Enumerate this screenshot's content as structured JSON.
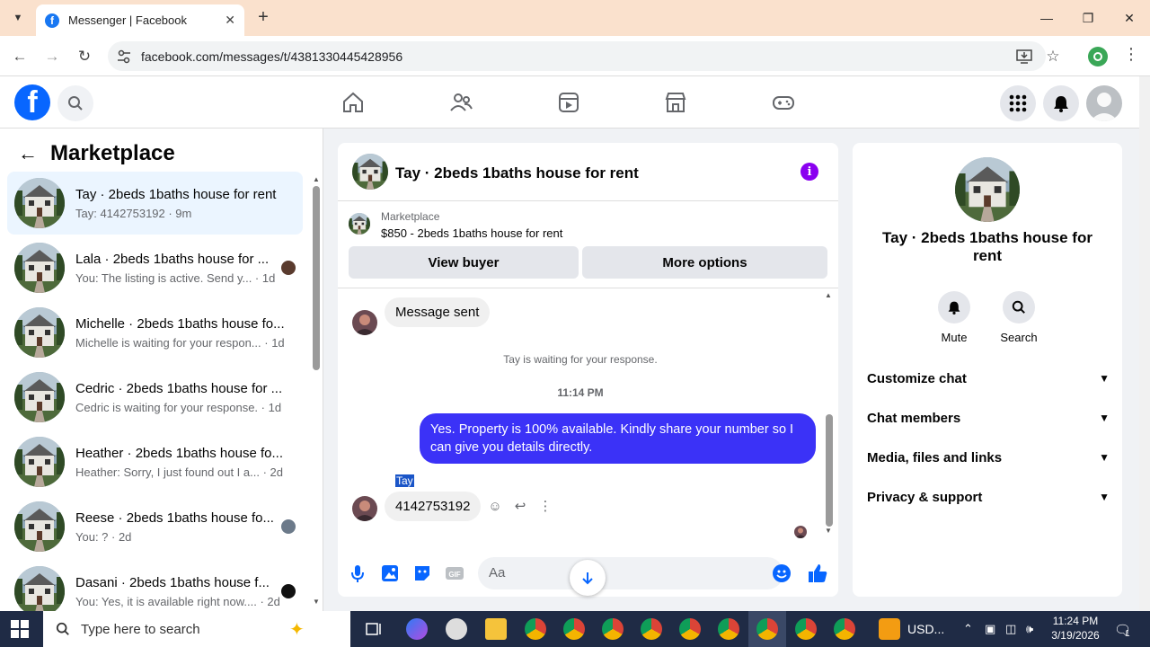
{
  "browser": {
    "tab_title": "Messenger | Facebook",
    "url": "facebook.com/messages/t/4381330445428956"
  },
  "left": {
    "title": "Marketplace",
    "conversations": [
      {
        "name": "Tay · 2beds 1baths house for rent",
        "preview": "Tay: 4142753192 · 9m",
        "active": true
      },
      {
        "name": "Lala · 2beds 1baths house for ...",
        "preview": "You: The listing is active. Send y... · 1d"
      },
      {
        "name": "Michelle · 2beds 1baths house fo...",
        "preview": "Michelle is waiting for your respon... · 1d"
      },
      {
        "name": "Cedric · 2beds 1baths house for ...",
        "preview": "Cedric is waiting for your response. · 1d"
      },
      {
        "name": "Heather · 2beds 1baths house fo...",
        "preview": "Heather: Sorry, I just found out I a... · 2d"
      },
      {
        "name": "Reese · 2beds 1baths house fo...",
        "preview": "You: ? · 2d"
      },
      {
        "name": "Dasani · 2beds 1baths house f...",
        "preview": "You: Yes, it is available right now.... · 2d"
      }
    ]
  },
  "chat": {
    "title": "Tay · 2beds 1baths house for rent",
    "marketplace_label": "Marketplace",
    "listing": "$850 - 2beds 1baths house for rent",
    "view_buyer": "View buyer",
    "more_options": "More options",
    "msg_sent": "Message sent",
    "system_notice": "Tay is waiting for your response.",
    "timestamp": "11:14 PM",
    "outgoing": "Yes. Property is 100% available. Kindly share your number so I can give you details directly.",
    "sender_name": "Tay",
    "incoming": "4142753192",
    "composer_placeholder": "Aa"
  },
  "right": {
    "name": "Tay · 2beds 1baths house for rent",
    "mute": "Mute",
    "search": "Search",
    "sections": [
      "Customize chat",
      "Chat members",
      "Media, files and links",
      "Privacy & support"
    ]
  },
  "taskbar": {
    "search_placeholder": "Type here to search",
    "currency": "USD...",
    "time": "11:24 PM",
    "date": "3/19/2026",
    "notif_count": "1"
  },
  "colors": {
    "fb_blue": "#0866ff",
    "outgoing_bubble": "#3b32f7",
    "info_purple": "#8a00f0"
  }
}
